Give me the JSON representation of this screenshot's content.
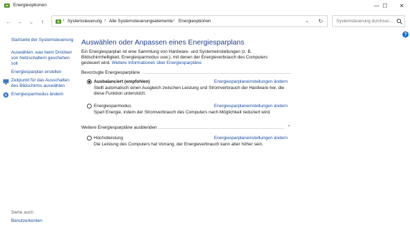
{
  "window": {
    "title": "Energieoptionen",
    "controls": [
      "—",
      "☐",
      "✕"
    ]
  },
  "nav": {
    "back": "←",
    "forward": "→",
    "recent": "⌄",
    "up": "↑",
    "breadcrumb": [
      "Systemsteuerung",
      "Alle Systemsteuerungselemente",
      "Energieoptionen"
    ],
    "separator": "›",
    "dropdown": "⌄",
    "refresh": "↻",
    "search_placeholder": "Systemsteuerung durchsuc..."
  },
  "help": "?",
  "sidebar": {
    "home": "Startseite der Systemsteuerung",
    "links": [
      "Auswählen, was beim Drücken",
      "von Netzschaltern geschehen",
      "soll"
    ],
    "create_plan": "Energiesparplan erstellen",
    "display_off": [
      "Zeitpunkt für das Ausschalten",
      "des Bildschirms auswählen"
    ],
    "change_mode": "Energiesparmodus ändern",
    "see_also_label": "Siehe auch",
    "user_accounts": "Benutzerkonten"
  },
  "main": {
    "heading": "Auswählen oder Anpassen eines Energiesparplans",
    "intro_text": "Ein Energiesparplan ist eine Sammlung von Hardware- und Systemeinstellungen (z. B. Bildschirmhelligkeit, Energiesparmodus usw.), mit denen der Energieverbrauch des Computers gesteuert wird.",
    "intro_link": "Weitere Informationen über Energiesparpläne",
    "preferred_label": "Bevorzugte Energiesparpläne",
    "hide_more_label": "Weitere Energiesparpläne ausblenden",
    "collapse": "⌃",
    "change_link": "Energiesparplaneinstellungen ändern",
    "plans": [
      {
        "name": "Ausbalanciert (empfohlen)",
        "desc": "Stellt automatisch einen Ausgleich zwischen Leistung und Stromverbrauch der Hardware her, die diese Funktion unterstützt.",
        "selected": true
      },
      {
        "name": "Energiesparmodus",
        "desc": "Spart Energie, indem der Stromverbrauch des Computers nach Möglichkeit reduziert wird.",
        "selected": false
      },
      {
        "name": "Höchstleistung",
        "desc": "Die Leistung des Computers hat Vorrang, der Energieverbrauch kann aber höher sein.",
        "selected": false
      }
    ]
  }
}
